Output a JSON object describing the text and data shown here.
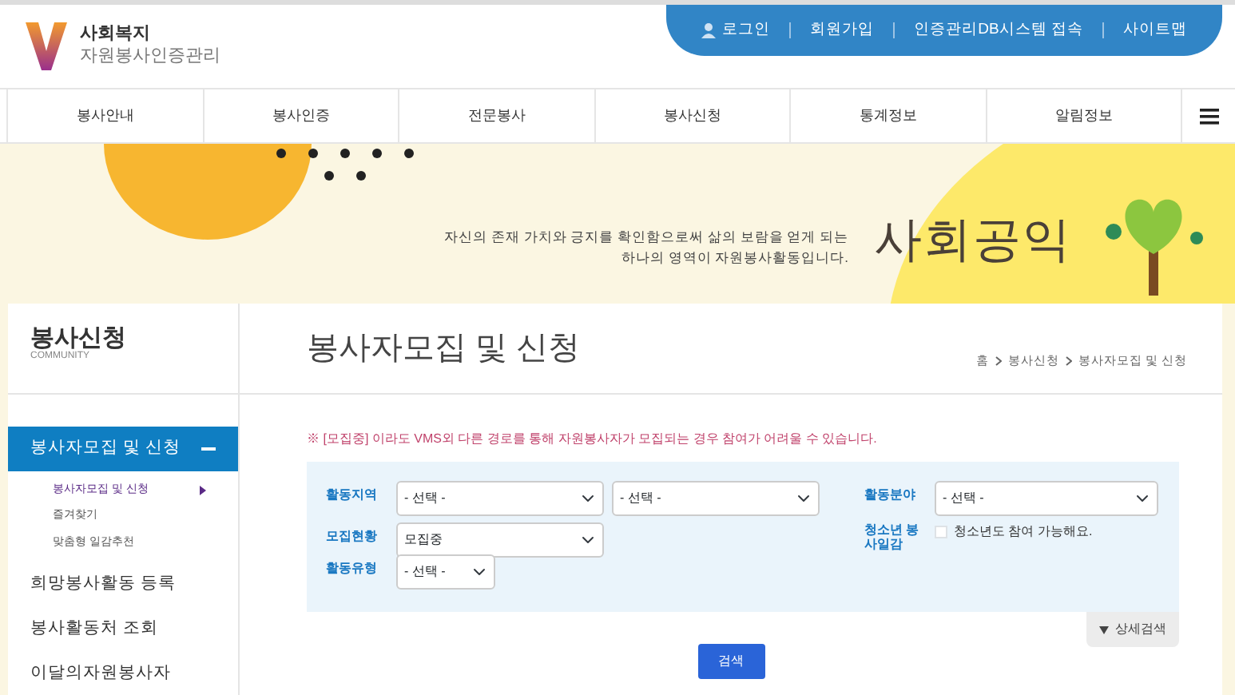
{
  "logo": {
    "line1": "사회복지",
    "line2": "자원봉사인증관리"
  },
  "top_links": [
    {
      "label": "로그인",
      "kind": "user"
    },
    {
      "label": "회원가입",
      "kind": "plain"
    },
    {
      "label": "인증관리DB시스템 접속",
      "kind": "plain"
    },
    {
      "label": "사이트맵",
      "kind": "plain"
    }
  ],
  "main_nav": [
    {
      "label": "봉사안내"
    },
    {
      "label": "봉사인증"
    },
    {
      "label": "전문봉사"
    },
    {
      "label": "봉사신청"
    },
    {
      "label": "통계정보"
    },
    {
      "label": "알림정보"
    }
  ],
  "banner": {
    "line1": "자신의 존재 가치와 긍지를 확인함으로써 삶의 보람을 얻게 되는",
    "line2": "하나의 영역이 자원봉사활동입니다.",
    "slogan": "사회공익"
  },
  "sidebar": {
    "title": "봉사신청",
    "subtitle": "COMMUNITY",
    "items": [
      {
        "label": "봉사자모집 및 신청",
        "selected": true,
        "expanded": true,
        "children": [
          {
            "label": "봉사자모집 및 신청",
            "selected": true
          },
          {
            "label": "즐겨찾기",
            "selected": false
          },
          {
            "label": "맞춤형 일감추천",
            "selected": false
          }
        ]
      },
      {
        "label": "희망봉사활동 등록",
        "selected": false
      },
      {
        "label": "봉사활동처 조회",
        "selected": false
      },
      {
        "label": "이달의자원봉사자",
        "selected": false
      }
    ]
  },
  "page": {
    "title": "봉사자모집 및 신청",
    "breadcrumb": [
      "홈",
      "봉사신청",
      "봉사자모집 및 신청"
    ]
  },
  "notice": "※ [모집중] 이라도 VMS외 다른 경로를 통해 자원봉사자가 모집되는 경우 참여가 어려울 수 있습니다.",
  "filters": {
    "region": {
      "label": "활동지역",
      "value1": "- 선택 -",
      "value2": "- 선택 -"
    },
    "field": {
      "label": "활동분야",
      "value": "- 선택 -"
    },
    "status": {
      "label": "모집현황",
      "value": "모집중"
    },
    "youth": {
      "label": "청소년 봉사일감",
      "option": "청소년도 참여 가능해요.",
      "checked": false
    },
    "type": {
      "label": "활동유형",
      "value": "- 선택 -"
    }
  },
  "detail_search": {
    "label": "상세검색",
    "expanded": false
  },
  "search_button": "검색"
}
